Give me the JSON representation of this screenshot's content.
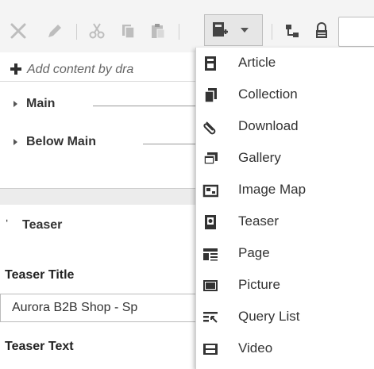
{
  "toolbar": {
    "buttons": [
      {
        "name": "close-icon"
      },
      {
        "name": "edit-pencil-icon"
      },
      {
        "name": "cut-icon"
      },
      {
        "name": "copy-icon"
      },
      {
        "name": "paste-icon"
      },
      {
        "name": "add-content-icon"
      },
      {
        "name": "dropdown-arrow-icon"
      },
      {
        "name": "hierarchy-icon"
      },
      {
        "name": "lock-icon"
      }
    ],
    "colors": {
      "disabled": "#bdbdbd",
      "active": "#444444"
    }
  },
  "content_hint": "Add content by dra",
  "sections": [
    {
      "label": "Main"
    },
    {
      "label": "Below Main"
    }
  ],
  "teaser_section": {
    "label": "Teaser"
  },
  "fields": {
    "title_label": "Teaser Title",
    "title_value": "Aurora B2B Shop - Sp",
    "text_label": "Teaser Text"
  },
  "menu": {
    "items": [
      {
        "label": "Article",
        "icon": "article-icon"
      },
      {
        "label": "Collection",
        "icon": "collection-icon"
      },
      {
        "label": "Download",
        "icon": "download-paperclip-icon"
      },
      {
        "label": "Gallery",
        "icon": "gallery-icon"
      },
      {
        "label": "Image Map",
        "icon": "image-map-icon"
      },
      {
        "label": "Teaser",
        "icon": "teaser-icon"
      },
      {
        "label": "Page",
        "icon": "page-icon"
      },
      {
        "label": "Picture",
        "icon": "picture-icon"
      },
      {
        "label": "Query List",
        "icon": "query-list-icon"
      },
      {
        "label": "Video",
        "icon": "video-icon"
      }
    ]
  }
}
